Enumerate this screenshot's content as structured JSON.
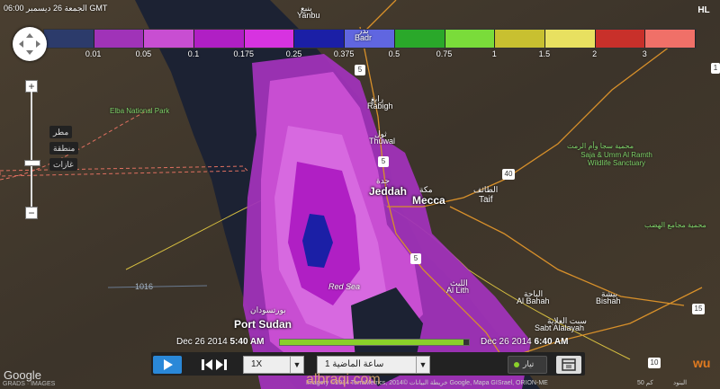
{
  "datetime_top": "06:00 الجمعة 26 ديسمبر GMT",
  "legend": {
    "colors": [
      "#2c3b6b",
      "#a033b8",
      "#c84ed2",
      "#b01fc4",
      "#d733e0",
      "#1b1fa6",
      "#6066e0",
      "#2aa82a",
      "#7adc3a",
      "#c8c030",
      "#e8e060",
      "#c8302a",
      "#f07068"
    ],
    "labels": [
      "0.01",
      "0.05",
      "0.1",
      "0.175",
      "0.25",
      "0.375",
      "0.5",
      "0.75",
      "1",
      "1.5",
      "2",
      "3"
    ]
  },
  "places": {
    "yanbu_ar": "ينبع",
    "yanbu": "Yanbu",
    "badr_ar": "بدر",
    "badr": "Badr",
    "rabigh_ar": "رابغ",
    "rabigh": "Rabigh",
    "thuwal_ar": "ثول",
    "thuwal": "Thuwal",
    "jeddah_ar": "جدة",
    "jeddah": "Jeddah",
    "mecca_ar": "مكة",
    "mecca": "Mecca",
    "taif_ar": "الطائف",
    "taif": "Taif",
    "port_sudan_ar": "بورتسودان",
    "port_sudan": "Port Sudan",
    "red_sea": "Red Sea",
    "al_lith_ar": "الليث",
    "al_lith": "Al Lith",
    "al_bahah_ar": "الباحة",
    "al_bahah": "Al Bahah",
    "bishah_ar": "بيشة",
    "bishah": "Bishah",
    "sabt_ar": "سبت العلاية",
    "sabt": "Sabt Alalayah",
    "elba": "Elba National Park",
    "saja_ar": "محمية سجا وأم الرمث",
    "saja": "Saja & Umm Al Ramth Wildlife Sanctuary",
    "hadab_ar": "محمية مجامع الهضب",
    "depth": "1016",
    "highway_5a": "5",
    "highway_5b": "5",
    "highway_5c": "5",
    "highway_40": "40",
    "highway_15": "15",
    "highway_10": "10",
    "highway_1": "1"
  },
  "layers": [
    "مطر",
    "منطقة",
    "غازات"
  ],
  "timeline": {
    "start_date": "Dec 26 2014",
    "start_time": "5:40 AM",
    "end_date": "Dec 26 2014",
    "end_time": "6:40 AM",
    "progress": 0.97
  },
  "controls": {
    "speed": "1X",
    "range": "1 ساعة الماضية",
    "toggle_label": "تيار"
  },
  "attribution": "Imagery ©2014 TerraMetrics, خريطة البيانات ©2014 Google, Mapa GISrael, ORION-ME",
  "terms": "البنود",
  "scale": "50 كم",
  "watermark": "albraqi.com",
  "logo_text": "Google",
  "imagery_credit": "GRADS · IMAGES",
  "hl_badge": "HL",
  "brand_logo": "wu",
  "colors": {
    "sea": "#1c2233",
    "land": "#3b3327",
    "accent": "#2a88d8"
  }
}
